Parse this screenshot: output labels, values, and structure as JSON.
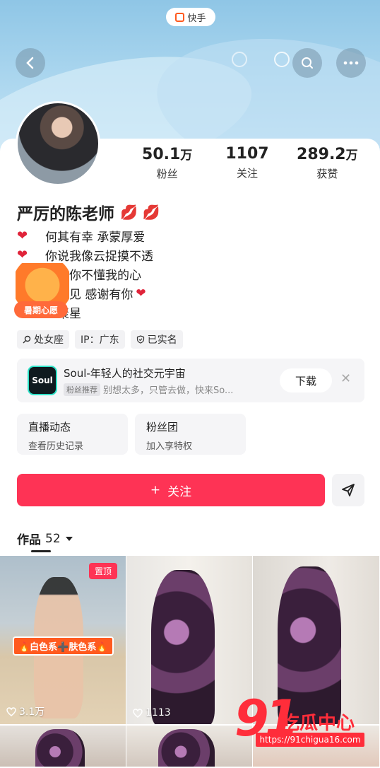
{
  "brand": {
    "name": "快手"
  },
  "profile": {
    "name": "严厉的陈老师",
    "name_emoji": "💋 💋",
    "stats": [
      {
        "value": "50.1",
        "unit": "万",
        "label": "粉丝"
      },
      {
        "value": "1107",
        "unit": "",
        "label": "关注"
      },
      {
        "value": "289.2",
        "unit": "万",
        "label": "获赞"
      }
    ],
    "bio": [
      {
        "icon": "heart",
        "text": "何其有幸 承蒙厚爱"
      },
      {
        "icon": "heart",
        "text": "你说我像云捉摸不透"
      },
      {
        "icon": "heart",
        "text": "其实你不懂我的心"
      },
      {
        "icon": "heart",
        "text": "因遇见 感谢有你",
        "trailing_icon": "heart"
      },
      {
        "icon": "heart",
        "text": "上聚星"
      }
    ],
    "sticker_label": "暑期心愿",
    "tags": [
      "处女座",
      "IP：广东",
      "已实名"
    ]
  },
  "ad": {
    "app_icon_text": "Soul",
    "title": "Soul-年轻人的社交元宇宙",
    "badge": "粉丝推荐",
    "subtitle": "别想太多，只管去做，快来So...",
    "download": "下载"
  },
  "cards": [
    {
      "title": "直播动态",
      "subtitle": "查看历史记录"
    },
    {
      "title": "粉丝团",
      "subtitle": "加入享特权"
    }
  ],
  "actions": {
    "follow": "关注",
    "follow_prefix": "+"
  },
  "works": {
    "label": "作品",
    "count": "52"
  },
  "videos": [
    {
      "pinned_label": "置顶",
      "overlay": "🔥白色系➕肤色系🔥",
      "likes": "3.1万"
    },
    {
      "likes": "1113"
    },
    {
      "likes": ""
    }
  ],
  "watermark": {
    "number": "91",
    "text": "吃瓜中心",
    "url": "https://91chigua16.com"
  },
  "colors": {
    "accent": "#fe3355",
    "heart": "#e0243a",
    "brand": "#ff5a1f"
  }
}
